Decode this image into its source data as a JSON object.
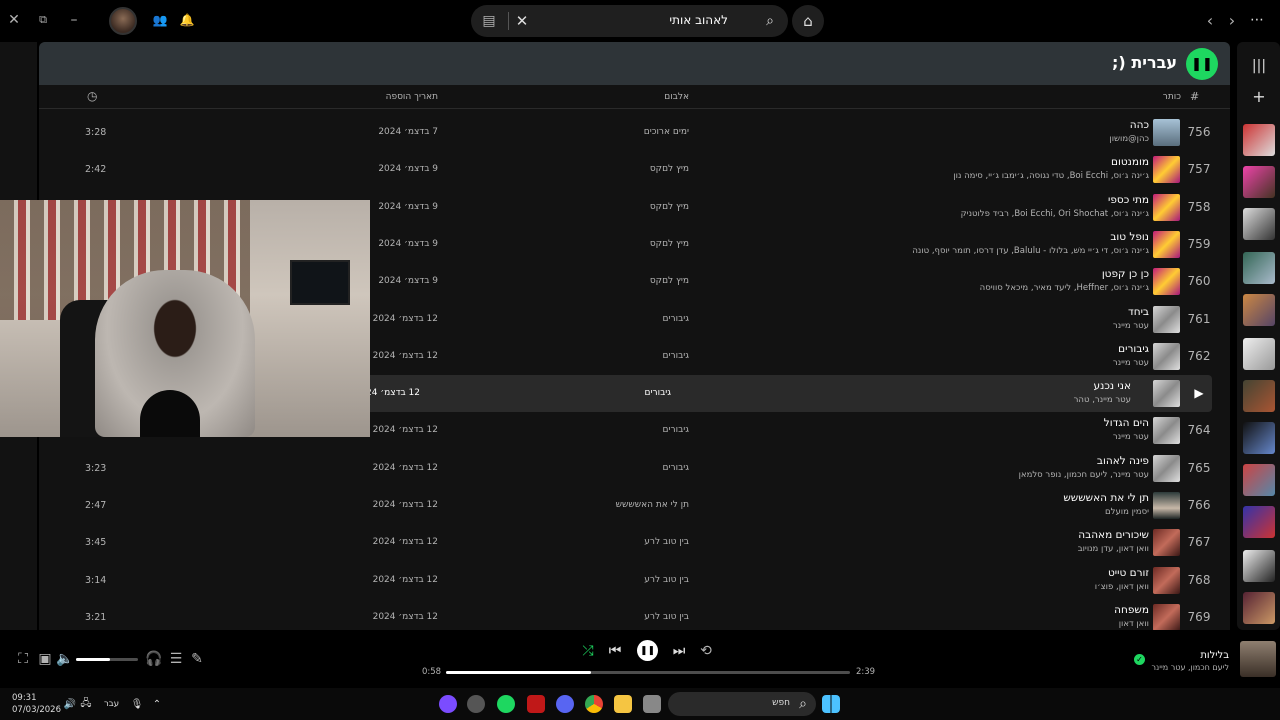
{
  "topbar": {
    "search_value": "לאהוב אותי",
    "window_icons": [
      "close-icon",
      "restore-icon",
      "minimize-icon"
    ],
    "nav_icons": [
      "back-icon",
      "forward-icon",
      "more-icon"
    ]
  },
  "playlist": {
    "title": "עברית (;",
    "columns": {
      "index": "#",
      "title": "כותר",
      "album": "אלבום",
      "date_added": "תאריך הוספה"
    }
  },
  "tracks": [
    {
      "index": "756",
      "title": "כהה",
      "artist": "כהן@מושון",
      "album": "ימים ארוכים",
      "date": "7 בדצמ׳ 2024",
      "duration": "3:28",
      "art": "cohen"
    },
    {
      "index": "757",
      "title": "מומנטום",
      "artist": "ג׳ינה ג׳וס, Boi Ecchi, טדי נגוסה, ג׳ימבו ג׳יי, סימה נון",
      "album": "מיץ לםקס",
      "date": "9 בדצמ׳ 2024",
      "duration": "2:42",
      "art": "pink"
    },
    {
      "index": "758",
      "title": "מתי כספי",
      "artist": "ג׳ינה ג׳וס, Boi Ecchi, Ori Shochat, רביד פלוטניק",
      "album": "מיץ לםקס",
      "date": "9 בדצמ׳ 2024",
      "duration": "",
      "art": "pink"
    },
    {
      "index": "759",
      "title": "נופל טוב",
      "artist": "ג׳ינה ג׳וס, די ג׳יי משׁ, בלולו - Balulu, עדן דרסו, תומר יוסף, טונה",
      "album": "מיץ לםקס",
      "date": "9 בדצמ׳ 2024",
      "duration": "",
      "art": "pink"
    },
    {
      "index": "760",
      "title": "כן כן קפטן",
      "artist": "ג׳ינה ג׳וס, Heffner, ליעד מאיר, מיכאל סוויסה",
      "album": "מיץ לםקס",
      "date": "9 בדצמ׳ 2024",
      "duration": "",
      "art": "pink"
    },
    {
      "index": "761",
      "title": "ביחד",
      "artist": "עטר מיינר",
      "album": "גיבורים",
      "date": "12 בדצמ׳ 2024",
      "duration": "",
      "art": "gray"
    },
    {
      "index": "762",
      "title": "גיבורים",
      "artist": "עטר מיינר",
      "album": "גיבורים",
      "date": "12 בדצמ׳ 2024",
      "duration": "",
      "art": "gray"
    },
    {
      "index": "",
      "title": "אני נכנע",
      "artist": "עטר מיינר, טהר",
      "album": "גיבורים",
      "date": "12 בדצמ׳ 2024",
      "duration": "",
      "art": "gray",
      "highlight": true
    },
    {
      "index": "764",
      "title": "הים הגדול",
      "artist": "עטר מיינר",
      "album": "גיבורים",
      "date": "12 בדצמ׳ 2024",
      "duration": "",
      "art": "gray"
    },
    {
      "index": "765",
      "title": "פינה לאהוב",
      "artist": "עטר מיינר, ליעם חכמון, נופר סלמאן",
      "album": "גיבורים",
      "date": "12 בדצמ׳ 2024",
      "duration": "3:23",
      "art": "gray"
    },
    {
      "index": "766",
      "title": "תן לי את האשששש",
      "artist": "יסמין מועלם",
      "album": "תן לי את האשששש",
      "date": "12 בדצמ׳ 2024",
      "duration": "2:47",
      "art": "yasmin"
    },
    {
      "index": "767",
      "title": "שיכורים מאהבה",
      "artist": "וואן דאון, עדן מנויוב",
      "album": "בין טוב לרע",
      "date": "12 בדצמ׳ 2024",
      "duration": "3:45",
      "art": "red"
    },
    {
      "index": "768",
      "title": "זורם טייט",
      "artist": "וואן דאון, פוצ׳ו",
      "album": "בין טוב לרע",
      "date": "12 בדצמ׳ 2024",
      "duration": "3:14",
      "art": "red"
    },
    {
      "index": "769",
      "title": "משפחה",
      "artist": "וואן דאון",
      "album": "בין טוב לרע",
      "date": "12 בדצמ׳ 2024",
      "duration": "3:21",
      "art": "red"
    }
  ],
  "player": {
    "now_playing_title": "בלילות",
    "now_playing_artist": "ליעם חכמון, עטר מיינר",
    "elapsed": "0:58",
    "total": "2:39",
    "progress_fraction": 0.36,
    "volume_fraction": 0.55
  },
  "taskbar": {
    "time": "09:31",
    "date": "07/03/2026",
    "language": "עבר",
    "search_placeholder": "חפש"
  },
  "colors": {
    "accent": "#1ed760",
    "background": "#121212",
    "header": "#2e3438"
  }
}
